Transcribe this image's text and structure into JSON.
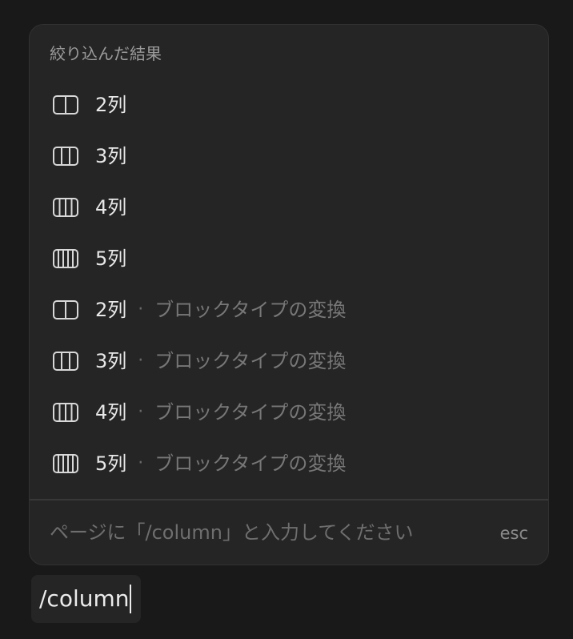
{
  "menu": {
    "header": "絞り込んだ結果",
    "items": [
      {
        "icon": "columns-2-icon",
        "cols": 2,
        "label": "2列",
        "subtitle": ""
      },
      {
        "icon": "columns-3-icon",
        "cols": 3,
        "label": "3列",
        "subtitle": ""
      },
      {
        "icon": "columns-4-icon",
        "cols": 4,
        "label": "4列",
        "subtitle": ""
      },
      {
        "icon": "columns-5-icon",
        "cols": 5,
        "label": "5列",
        "subtitle": ""
      },
      {
        "icon": "columns-2-icon",
        "cols": 2,
        "label": "2列",
        "separator": "·",
        "subtitle": "ブロックタイプの変換"
      },
      {
        "icon": "columns-3-icon",
        "cols": 3,
        "label": "3列",
        "separator": "·",
        "subtitle": "ブロックタイプの変換"
      },
      {
        "icon": "columns-4-icon",
        "cols": 4,
        "label": "4列",
        "separator": "·",
        "subtitle": "ブロックタイプの変換"
      },
      {
        "icon": "columns-5-icon",
        "cols": 5,
        "label": "5列",
        "separator": "·",
        "subtitle": "ブロックタイプの変換"
      }
    ],
    "footer_hint": "ページに「/column」と入力してください",
    "footer_esc": "esc"
  },
  "editor": {
    "text": "/column"
  },
  "colors": {
    "background": "#191919",
    "menu_bg": "#252525",
    "text": "#e8e8e8",
    "muted": "#777777"
  }
}
